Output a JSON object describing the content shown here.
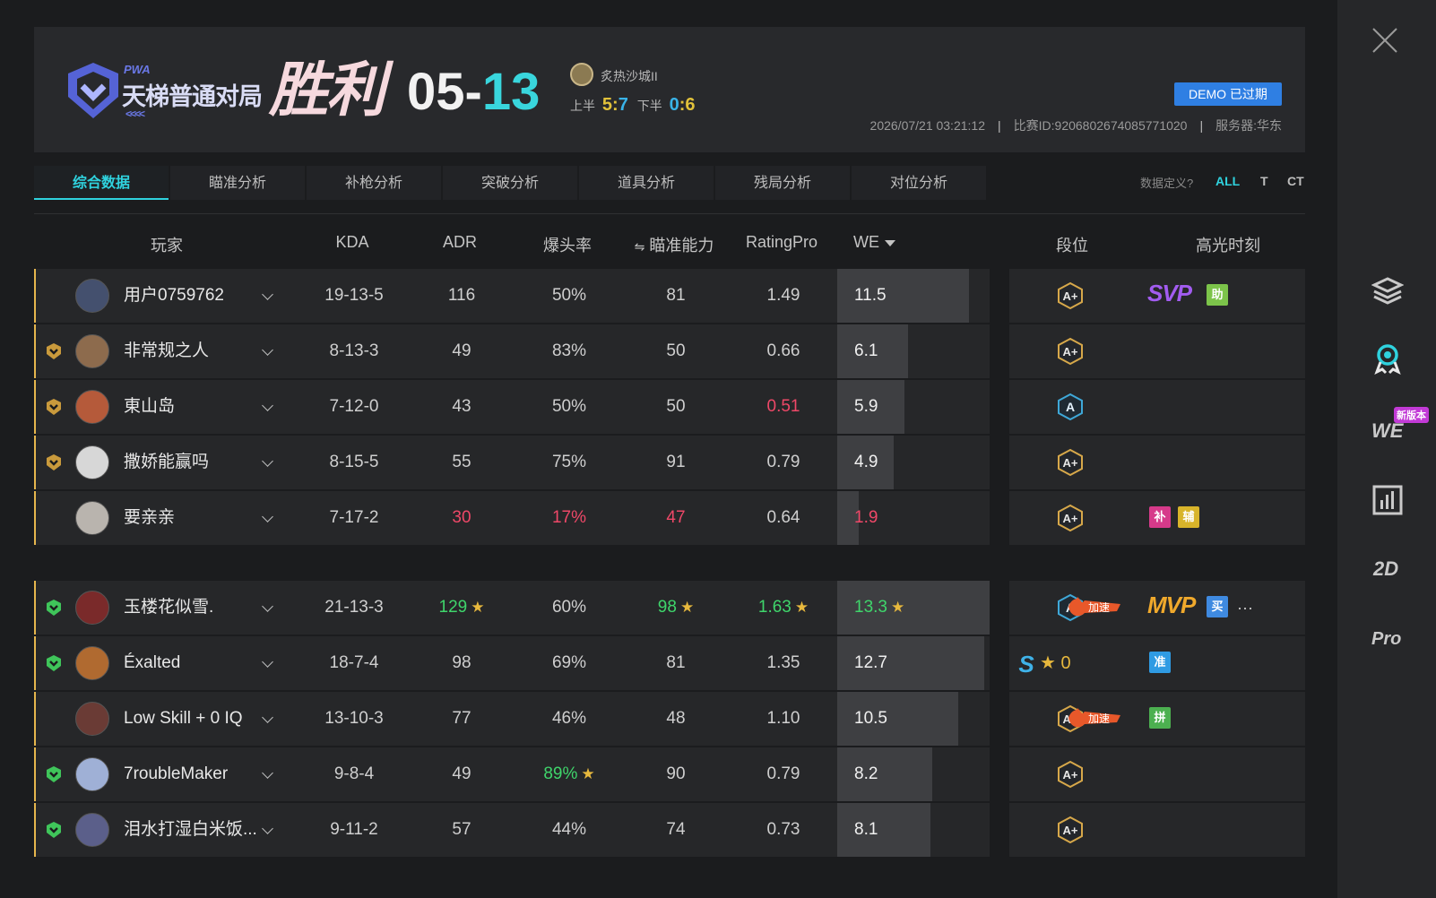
{
  "header": {
    "logo_tag": "PWA",
    "logo_title": "天梯普通对局",
    "logo_arrows": "<<<<",
    "result": "胜利",
    "score_left": "05-",
    "score_right": "13",
    "map_name": "炙热沙城II",
    "first_half_label": "上半",
    "first_half_a": "5",
    "first_half_b": "7",
    "second_half_label": "下半",
    "second_half_a": "0",
    "second_half_b": "6",
    "colon": ":",
    "demo_label": "DEMO 已过期",
    "datetime": "2026/07/21 03:21:12",
    "match_id": "比赛ID:9206802674085771020",
    "server": "服务器:华东",
    "sep": "|"
  },
  "tabs": [
    "综合数据",
    "瞄准分析",
    "补枪分析",
    "突破分析",
    "道具分析",
    "残局分析",
    "对位分析"
  ],
  "filter": {
    "label": "数据定义?",
    "options": [
      "ALL",
      "T",
      "CT"
    ]
  },
  "columns": {
    "player": "玩家",
    "kda": "KDA",
    "adr": "ADR",
    "hs": "爆头率",
    "aim": "瞄准能力",
    "aim_prefix": "⇋",
    "rating": "RatingPro",
    "we": "WE",
    "rank": "段位",
    "highlight": "高光时刻"
  },
  "team_a": [
    {
      "name": "用户0759762",
      "kda": "19-13-5",
      "adr": "116",
      "hs": "50%",
      "aim": "81",
      "rating": "1.49",
      "we": "11.5",
      "we_frac": 0.86,
      "rank": "A+",
      "highlight": "SVP",
      "tags": [
        "助"
      ]
    },
    {
      "name": "非常规之人",
      "kda": "8-13-3",
      "adr": "49",
      "hs": "83%",
      "aim": "50",
      "rating": "0.66",
      "we": "6.1",
      "we_frac": 0.46,
      "rank": "A+"
    },
    {
      "name": "東山岛",
      "kda": "7-12-0",
      "adr": "43",
      "hs": "50%",
      "aim": "50",
      "rating": "0.51",
      "we": "5.9",
      "we_frac": 0.44,
      "rank": "A"
    },
    {
      "name": "撒娇能赢吗",
      "kda": "8-15-5",
      "adr": "55",
      "hs": "75%",
      "aim": "91",
      "rating": "0.79",
      "we": "4.9",
      "we_frac": 0.37,
      "rank": "A+"
    },
    {
      "name": "要亲亲",
      "kda": "7-17-2",
      "adr": "30",
      "hs": "17%",
      "aim": "47",
      "rating": "0.64",
      "we": "1.9",
      "we_frac": 0.14,
      "rank": "A+",
      "tags": [
        "补",
        "辅"
      ]
    }
  ],
  "team_b": [
    {
      "name": "玉楼花似雪.",
      "kda": "21-13-3",
      "adr": "129",
      "hs": "60%",
      "aim": "98",
      "rating": "1.63",
      "we": "13.3",
      "we_frac": 1.0,
      "rank": "A",
      "boost": "加速",
      "highlight": "MVP",
      "tags": [
        "买"
      ],
      "more": "···"
    },
    {
      "name": "Éxalted",
      "kda": "18-7-4",
      "adr": "98",
      "hs": "69%",
      "aim": "81",
      "rating": "1.35",
      "we": "12.7",
      "we_frac": 0.96,
      "rank": "S",
      "rank_stars": "0",
      "tags": [
        "准"
      ]
    },
    {
      "name": "Low Skill + 0 IQ",
      "kda": "13-10-3",
      "adr": "77",
      "hs": "46%",
      "aim": "48",
      "rating": "1.10",
      "we": "10.5",
      "we_frac": 0.79,
      "rank": "A+",
      "boost": "加速",
      "tags": [
        "拼"
      ]
    },
    {
      "name": "7roubleMaker",
      "kda": "9-8-4",
      "adr": "49",
      "hs": "89%",
      "aim": "90",
      "rating": "0.79",
      "we": "8.2",
      "we_frac": 0.62,
      "rank": "A+"
    },
    {
      "name": "泪水打湿白米饭...",
      "kda": "9-11-2",
      "adr": "57",
      "hs": "44%",
      "aim": "74",
      "rating": "0.73",
      "we": "8.1",
      "we_frac": 0.61,
      "rank": "A+"
    }
  ],
  "rightbar": {
    "new_badge": "新版本",
    "we": "WE",
    "twod": "2D",
    "pro": "Pro"
  },
  "colors": {
    "accent": "#2fd2de",
    "red": "#ef4868",
    "green": "#3fd56b",
    "gold": "#e6b64d"
  }
}
